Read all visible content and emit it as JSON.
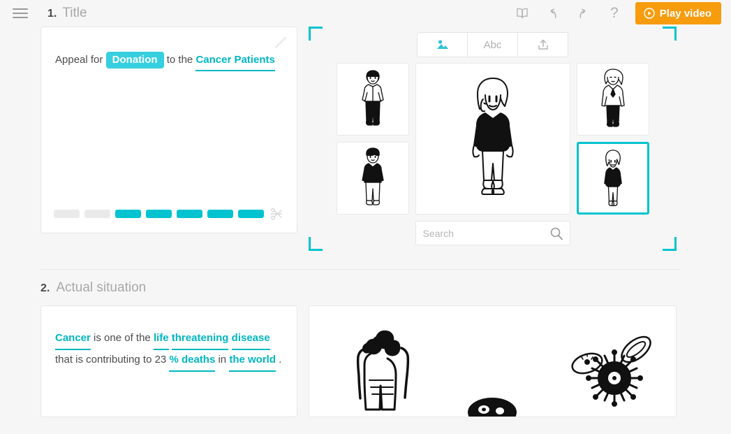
{
  "topbar": {
    "menu_icon": "hamburger-icon",
    "breadcrumb_number": "1.",
    "breadcrumb_title": "Title",
    "icons": [
      {
        "name": "book-icon",
        "glyph": "book"
      },
      {
        "name": "undo-icon",
        "glyph": "undo"
      },
      {
        "name": "redo-icon",
        "glyph": "redo"
      },
      {
        "name": "help-icon",
        "glyph": "?"
      }
    ],
    "play_button_label": "Play video",
    "play_button_color": "#f79c0d"
  },
  "scene1": {
    "script": {
      "prefix": "Appeal for",
      "chip": "Donation",
      "middle": "to the",
      "link": "Cancer Patients",
      "edit_icon": "pencil-icon"
    },
    "timeline": {
      "segments": [
        "off",
        "off",
        "on",
        "on",
        "on",
        "on",
        "on"
      ],
      "cut_icon": "scissors-icon",
      "off_color": "#eaeaea",
      "on_color": "#00c3cf"
    },
    "picker": {
      "tabs": [
        {
          "name": "tab-characters",
          "label": "",
          "icon": "image-icon",
          "active": true
        },
        {
          "name": "tab-text",
          "label": "Abc",
          "icon": "",
          "active": false
        },
        {
          "name": "tab-upload",
          "label": "",
          "icon": "upload-icon",
          "active": false
        }
      ],
      "thumbs_left": [
        {
          "name": "character-thumb-man-white-shirt",
          "selected": false
        },
        {
          "name": "character-thumb-man-black-sweater",
          "selected": false
        }
      ],
      "thumbs_right": [
        {
          "name": "character-thumb-woman-blazer",
          "selected": false
        },
        {
          "name": "character-thumb-woman-black-tee",
          "selected": true
        }
      ],
      "preview": {
        "name": "character-preview-woman-black-tee"
      },
      "search_placeholder": "Search",
      "search_value": "",
      "search_icon": "search-icon",
      "selection_color": "#00c3cf"
    }
  },
  "section2": {
    "number": "2.",
    "title": "Actual situation",
    "script": {
      "l1_a": "Cancer",
      "l1_b": "is one of the",
      "l1_c": "life",
      "l1_d": "threatening",
      "l2_a": "disease",
      "l2_b": "that is contributing to 23",
      "l2_c": "% deaths",
      "l2_d": "in",
      "l3_a": "the world",
      "l3_b": "."
    },
    "canvas": {
      "illustration_left": "crowd-of-people-illustration",
      "illustration_center": "cell-illustration",
      "illustration_right": "virus-bacteria-illustration"
    }
  },
  "theme": {
    "accent_cyan": "#00b6c2",
    "chip_cyan": "#35cfdf",
    "orange": "#f79c0d",
    "page_bg": "#f6f6f6"
  }
}
